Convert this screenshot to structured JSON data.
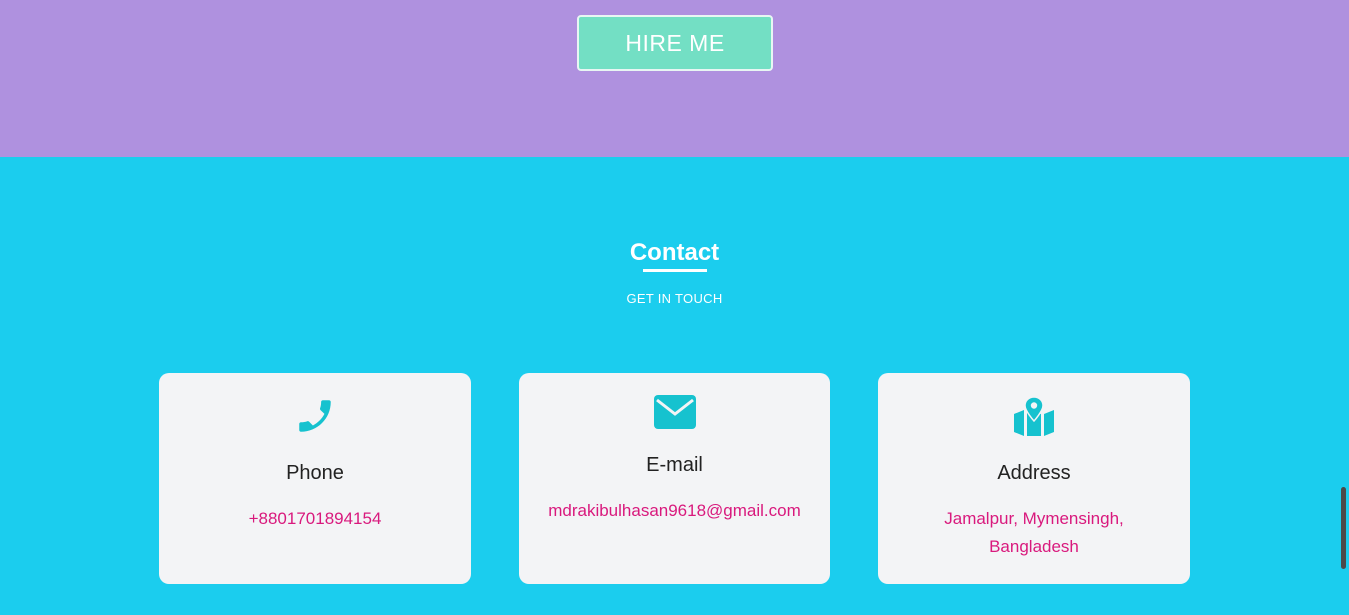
{
  "hero": {
    "hire_button_label": "HIRE ME"
  },
  "contact": {
    "title": "Contact",
    "subtitle": "GET IN TOUCH",
    "cards": [
      {
        "icon": "phone-icon",
        "label": "Phone",
        "value": "+8801701894154"
      },
      {
        "icon": "envelope-icon",
        "label": "E-mail",
        "value": "mdrakibulhasan9618@gmail.com"
      },
      {
        "icon": "map-marker-icon",
        "label": "Address",
        "value": "Jamalpur, Mymensingh, Bangladesh"
      }
    ]
  },
  "colors": {
    "hero_bg": "#af91df",
    "hire_button_bg": "#73dfc4",
    "contact_bg": "#1bcdee",
    "card_bg": "#f3f4f6",
    "icon_accent": "#16c2cf",
    "value_text": "#d9197d"
  }
}
